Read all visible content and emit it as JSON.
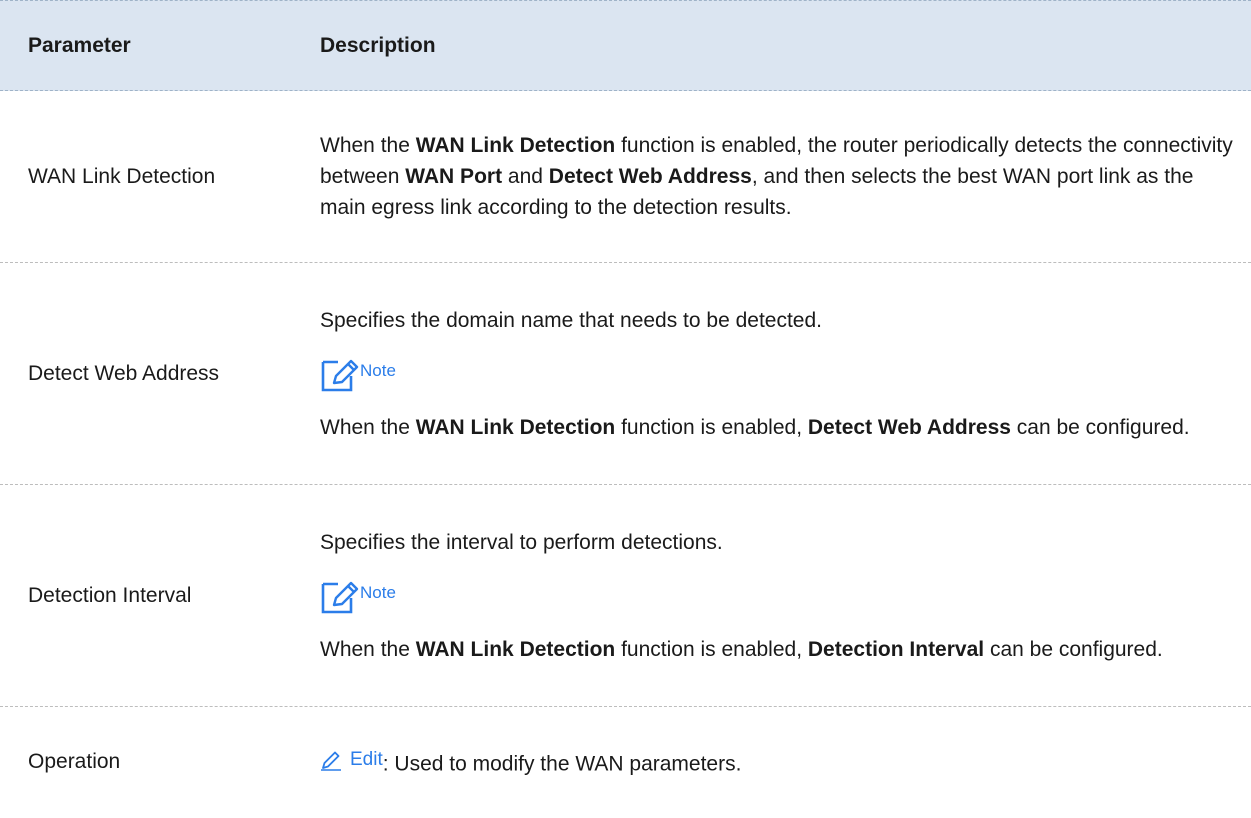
{
  "header": {
    "param": "Parameter",
    "desc": "Description"
  },
  "rows": [
    {
      "param": "WAN Link Detection",
      "desc": {
        "t1": "When the ",
        "b1": "WAN Link Detection",
        "t2": " function is enabled, the router periodically detects the connectivity between ",
        "b2": "WAN Port",
        "t3": " and ",
        "b3": "Detect Web Address",
        "t4": ", and then selects the best WAN port link as the main egress link according to the detection results."
      }
    },
    {
      "param": "Detect Web Address",
      "desc": {
        "intro": "Specifies the domain name that needs to be detected.",
        "note": "Note",
        "t1": "When the ",
        "b1": "WAN Link Detection",
        "t2": " function is enabled, ",
        "b2": "Detect Web Address",
        "t3": " can be configured."
      }
    },
    {
      "param": "Detection Interval",
      "desc": {
        "intro": "Specifies the interval to perform detections.",
        "note": "Note",
        "t1": "When the ",
        "b1": "WAN Link Detection",
        "t2": " function is enabled, ",
        "b2": "Detection Interval",
        "t3": " can be configured."
      }
    },
    {
      "param": "Operation",
      "desc": {
        "edit_label": "Edit",
        "text": ": Used to modify the WAN parameters."
      }
    }
  ],
  "colors": {
    "header_bg": "#dbe5f1",
    "accent": "#2b7de9"
  },
  "icons": {
    "note": "note-pencil-icon",
    "edit": "edit-pencil-icon"
  }
}
